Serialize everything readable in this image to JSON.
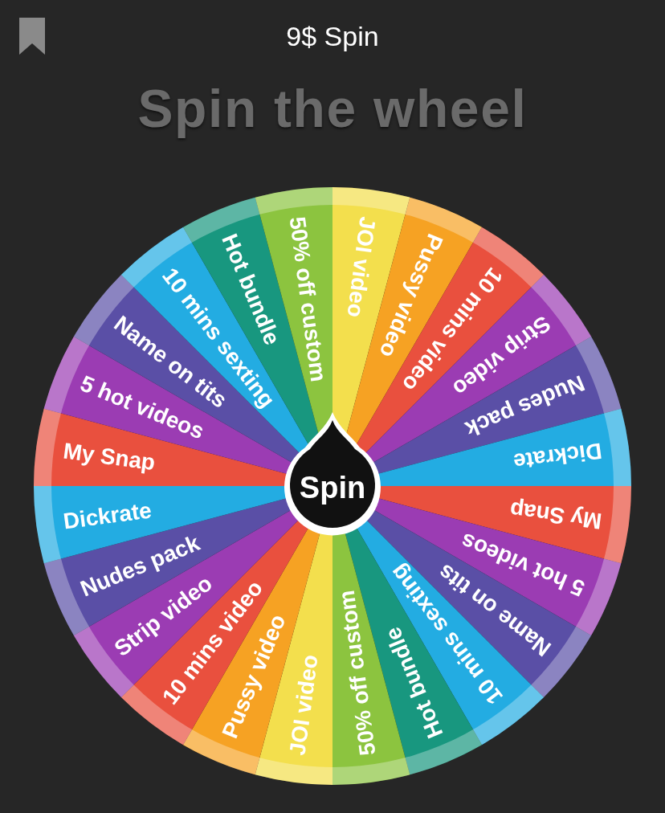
{
  "header": {
    "title": "9$ Spin"
  },
  "heading": "Spin the wheel",
  "wheel": {
    "button": "Spin",
    "segments": [
      {
        "label": "JOI video",
        "color": "#f3df4d"
      },
      {
        "label": "Pussy video",
        "color": "#f6a223"
      },
      {
        "label": "10 mins video",
        "color": "#e9503e"
      },
      {
        "label": "Strip video",
        "color": "#9b3cb3"
      },
      {
        "label": "Nudes pack",
        "color": "#5a4fa6"
      },
      {
        "label": "Dickrate",
        "color": "#23ace2"
      },
      {
        "label": "My Snap",
        "color": "#e9503e"
      },
      {
        "label": "5 hot videos",
        "color": "#9b3cb3"
      },
      {
        "label": "Name on tits",
        "color": "#5a4fa6"
      },
      {
        "label": "10 mins sexting",
        "color": "#23ace2"
      },
      {
        "label": "Hot bundle",
        "color": "#18977f"
      },
      {
        "label": "50% off custom",
        "color": "#8cc43f"
      },
      {
        "label": "JOI video",
        "color": "#f3df4d"
      },
      {
        "label": "Pussy video",
        "color": "#f6a223"
      },
      {
        "label": "10 mins video",
        "color": "#e9503e"
      },
      {
        "label": "Strip video",
        "color": "#9b3cb3"
      },
      {
        "label": "Nudes pack",
        "color": "#5a4fa6"
      },
      {
        "label": "Dickrate",
        "color": "#23ace2"
      },
      {
        "label": "My Snap",
        "color": "#e9503e"
      },
      {
        "label": "5 hot videos",
        "color": "#9b3cb3"
      },
      {
        "label": "Name on tits",
        "color": "#5a4fa6"
      },
      {
        "label": "10 mins sexting",
        "color": "#23ace2"
      },
      {
        "label": "Hot bundle",
        "color": "#18977f"
      },
      {
        "label": "50% off custom",
        "color": "#8cc43f"
      }
    ]
  }
}
